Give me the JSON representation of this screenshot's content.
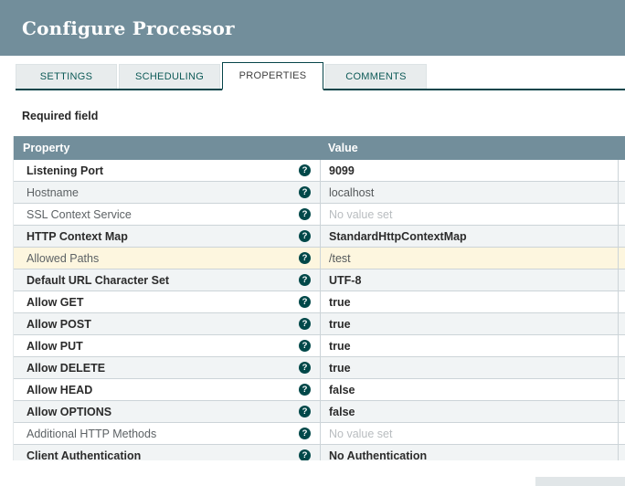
{
  "titlebar": {
    "title": "Configure Processor"
  },
  "tabs": {
    "items": [
      {
        "label": "SETTINGS",
        "active": false
      },
      {
        "label": "SCHEDULING",
        "active": false
      },
      {
        "label": "PROPERTIES",
        "active": true
      },
      {
        "label": "COMMENTS",
        "active": false
      }
    ]
  },
  "main": {
    "required_field_label": "Required field"
  },
  "properties_table": {
    "headers": {
      "property": "Property",
      "value": "Value"
    },
    "help_icon_glyph": "?",
    "rows": [
      {
        "property": "Listening Port",
        "value": "9099",
        "required": true,
        "muted": false,
        "highlighted": false
      },
      {
        "property": "Hostname",
        "value": "localhost",
        "required": false,
        "muted": false,
        "highlighted": false
      },
      {
        "property": "SSL Context Service",
        "value": "No value set",
        "required": false,
        "muted": true,
        "highlighted": false
      },
      {
        "property": "HTTP Context Map",
        "value": "StandardHttpContextMap",
        "required": true,
        "muted": false,
        "highlighted": false
      },
      {
        "property": "Allowed Paths",
        "value": "/test",
        "required": false,
        "muted": false,
        "highlighted": true
      },
      {
        "property": "Default URL Character Set",
        "value": "UTF-8",
        "required": true,
        "muted": false,
        "highlighted": false
      },
      {
        "property": "Allow GET",
        "value": "true",
        "required": true,
        "muted": false,
        "highlighted": false
      },
      {
        "property": "Allow POST",
        "value": "true",
        "required": true,
        "muted": false,
        "highlighted": false
      },
      {
        "property": "Allow PUT",
        "value": "true",
        "required": true,
        "muted": false,
        "highlighted": false
      },
      {
        "property": "Allow DELETE",
        "value": "true",
        "required": true,
        "muted": false,
        "highlighted": false
      },
      {
        "property": "Allow HEAD",
        "value": "false",
        "required": true,
        "muted": false,
        "highlighted": false
      },
      {
        "property": "Allow OPTIONS",
        "value": "false",
        "required": true,
        "muted": false,
        "highlighted": false
      },
      {
        "property": "Additional HTTP Methods",
        "value": "No value set",
        "required": false,
        "muted": true,
        "highlighted": false
      },
      {
        "property": "Client Authentication",
        "value": "No Authentication",
        "required": true,
        "muted": false,
        "highlighted": false
      }
    ]
  },
  "colors": {
    "titlebar_bg": "#728e9b",
    "accent_teal": "#004849",
    "tab_inactive_bg": "#e8eced",
    "tab_text": "#0d5a57",
    "table_header_bg": "#728e9b",
    "row_stripe": "#f1f4f5",
    "row_highlight": "#fdf6df",
    "muted_text": "#b9bdc0"
  }
}
